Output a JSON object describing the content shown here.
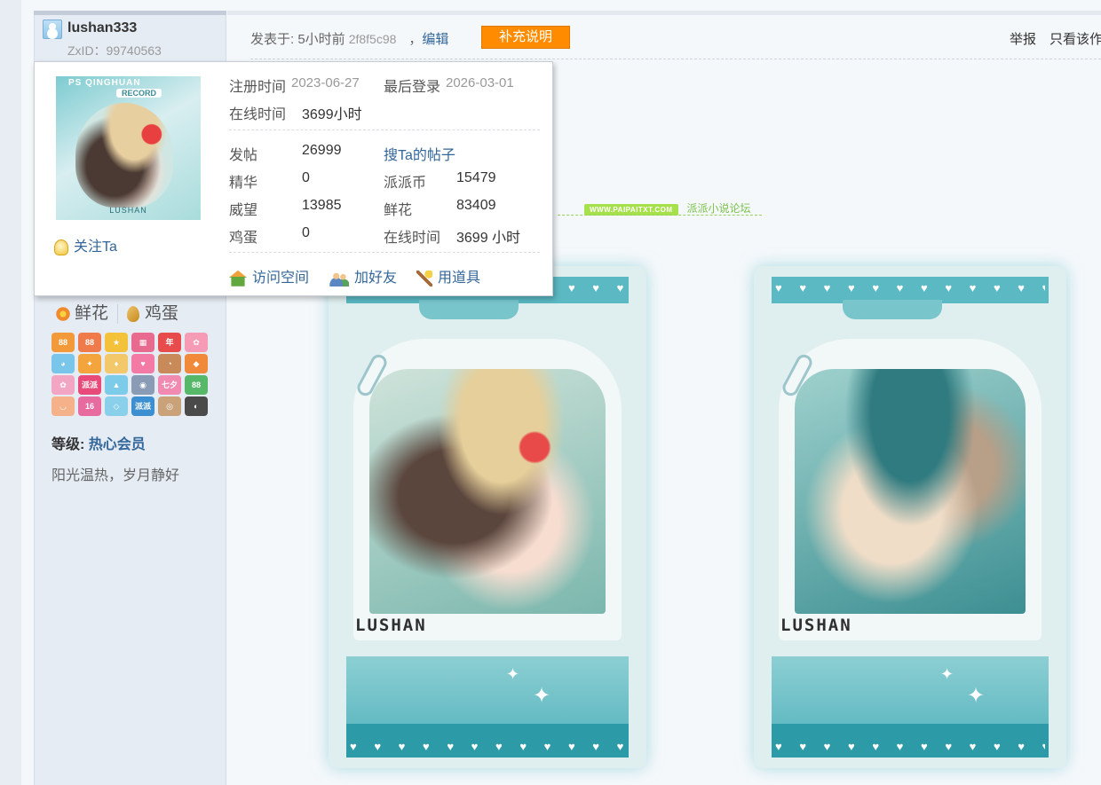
{
  "user": {
    "username": "lushan333",
    "zxid": "ZxID：99740563",
    "level_label": "等级:",
    "level_value": "热心会员",
    "signature": "阳光温热，岁月静好"
  },
  "post": {
    "posted_prefix": "发表于: 5小时前",
    "hash": "2f8f5c98",
    "comma": "，",
    "edit": "编辑",
    "supplement": "补充说明",
    "report": "举报",
    "only_view": "只看该作"
  },
  "banner": {
    "site": "WWW.PAIPAITXT.COM",
    "forum": "派派小说论坛"
  },
  "card": {
    "signature": "LUSHAN",
    "hearts": "♥ ♥ ♥ ♥ ♥ ♥ ♥ ♥ ♥ ♥ ♥ ♥ ♥"
  },
  "popup": {
    "avatar_title": "PS QINGHUAN",
    "avatar_badge": "RECORD",
    "avatar_sig": "LUSHAN",
    "follow": "关注Ta",
    "reg_label": "注册时间",
    "reg_value": "2023-06-27",
    "last_login_label": "最后登录",
    "last_login_value": "2026-03-01",
    "online_label": "在线时间",
    "online_value": "3699小时",
    "posts_label": "发帖",
    "posts_value": "26999",
    "search_posts": "搜Ta的帖子",
    "digest_label": "精华",
    "digest_value": "0",
    "coins_label": "派派币",
    "coins_value": "15479",
    "prestige_label": "威望",
    "prestige_value": "13985",
    "flowers_label": "鲜花",
    "flowers_value": "83409",
    "eggs_label": "鸡蛋",
    "eggs_value": "0",
    "online2_label": "在线时间",
    "online2_value": "3699 小时",
    "visit_space": "访问空间",
    "add_friend": "加好友",
    "use_item": "用道具"
  },
  "sidebar": {
    "flower": "鲜花",
    "egg": "鸡蛋",
    "medals": [
      {
        "text": "88",
        "color": "#f29a3a"
      },
      {
        "text": "88",
        "color": "#f07b4a"
      },
      {
        "text": "★",
        "color": "#f4c23a"
      },
      {
        "text": "▦",
        "color": "#e86b8f"
      },
      {
        "text": "年",
        "color": "#e84b4b"
      },
      {
        "text": "✿",
        "color": "#f59bb5"
      },
      {
        "text": "◕",
        "color": "#7ac5ea"
      },
      {
        "text": "✦",
        "color": "#f3a43c"
      },
      {
        "text": "♦",
        "color": "#f2c86b"
      },
      {
        "text": "♥",
        "color": "#f37aa5"
      },
      {
        "text": "◔",
        "color": "#c98a5a"
      },
      {
        "text": "◆",
        "color": "#f08a3a"
      },
      {
        "text": "✿",
        "color": "#f2a6c3"
      },
      {
        "text": "派派",
        "color": "#e84b7a"
      },
      {
        "text": "▲",
        "color": "#7ccbe8"
      },
      {
        "text": "◉",
        "color": "#8a9bb5"
      },
      {
        "text": "七夕",
        "color": "#f08ab0"
      },
      {
        "text": "88",
        "color": "#58b86a"
      },
      {
        "text": "◡",
        "color": "#f5b28a"
      },
      {
        "text": "16",
        "color": "#e86ba0"
      },
      {
        "text": "◇",
        "color": "#8ad0ea"
      },
      {
        "text": "派派",
        "color": "#3c8fd0"
      },
      {
        "text": "◎",
        "color": "#c9a27a"
      },
      {
        "text": "◐",
        "color": "#4a4a4a"
      }
    ]
  }
}
